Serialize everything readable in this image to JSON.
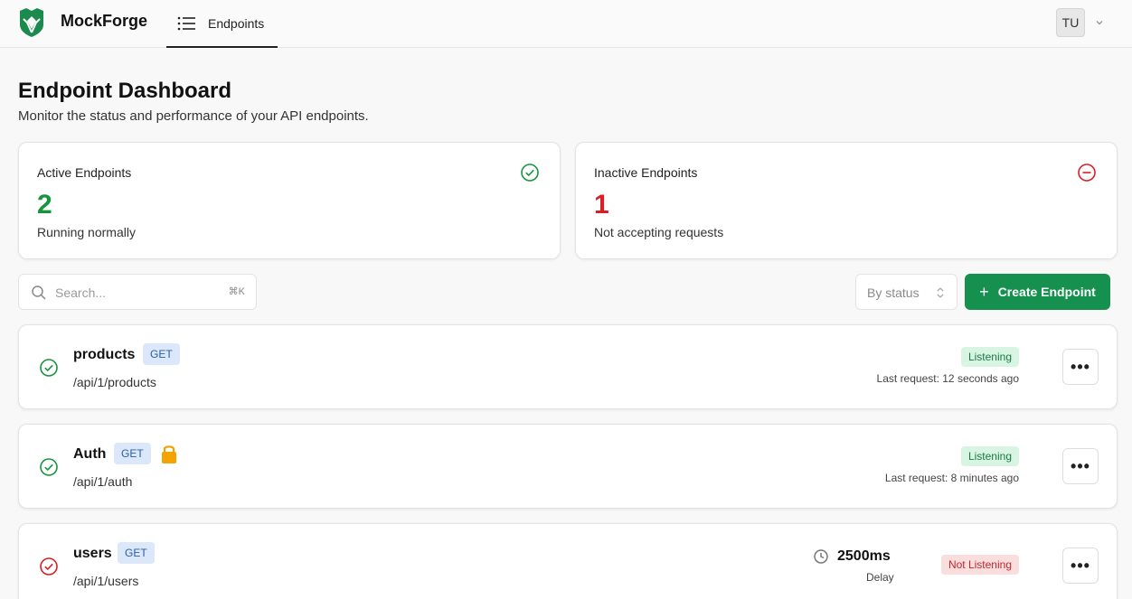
{
  "app": {
    "name": "MockForge"
  },
  "nav": {
    "tab_label": "Endpoints"
  },
  "user": {
    "initials": "TU"
  },
  "header": {
    "title": "Endpoint Dashboard",
    "subtitle": "Monitor the status and performance of your API endpoints."
  },
  "stats": {
    "active": {
      "label": "Active Endpoints",
      "count": "2",
      "note": "Running normally",
      "color": "#17943d"
    },
    "inactive": {
      "label": "Inactive Endpoints",
      "count": "1",
      "note": "Not accepting requests",
      "color": "#d71f25"
    }
  },
  "toolbar": {
    "search_placeholder": "Search...",
    "search_shortcut": "⌘K",
    "filter_label": "By status",
    "create_label": "Create Endpoint"
  },
  "endpoints": [
    {
      "name": "products",
      "method": "GET",
      "path": "/api/1/products",
      "status": "Listening",
      "last_request": "Last request: 12 seconds ago",
      "locked": false
    },
    {
      "name": "Auth",
      "method": "GET",
      "path": "/api/1/auth",
      "status": "Listening",
      "last_request": "Last request: 8 minutes ago",
      "locked": true
    },
    {
      "name": "users",
      "method": "GET",
      "path": "/api/1/users",
      "status": "Not Listening",
      "delay": "2500ms",
      "delay_label": "Delay",
      "locked": false
    }
  ],
  "colors": {
    "primary": "#15904f",
    "active": "#17943d",
    "inactive": "#d71f25"
  }
}
